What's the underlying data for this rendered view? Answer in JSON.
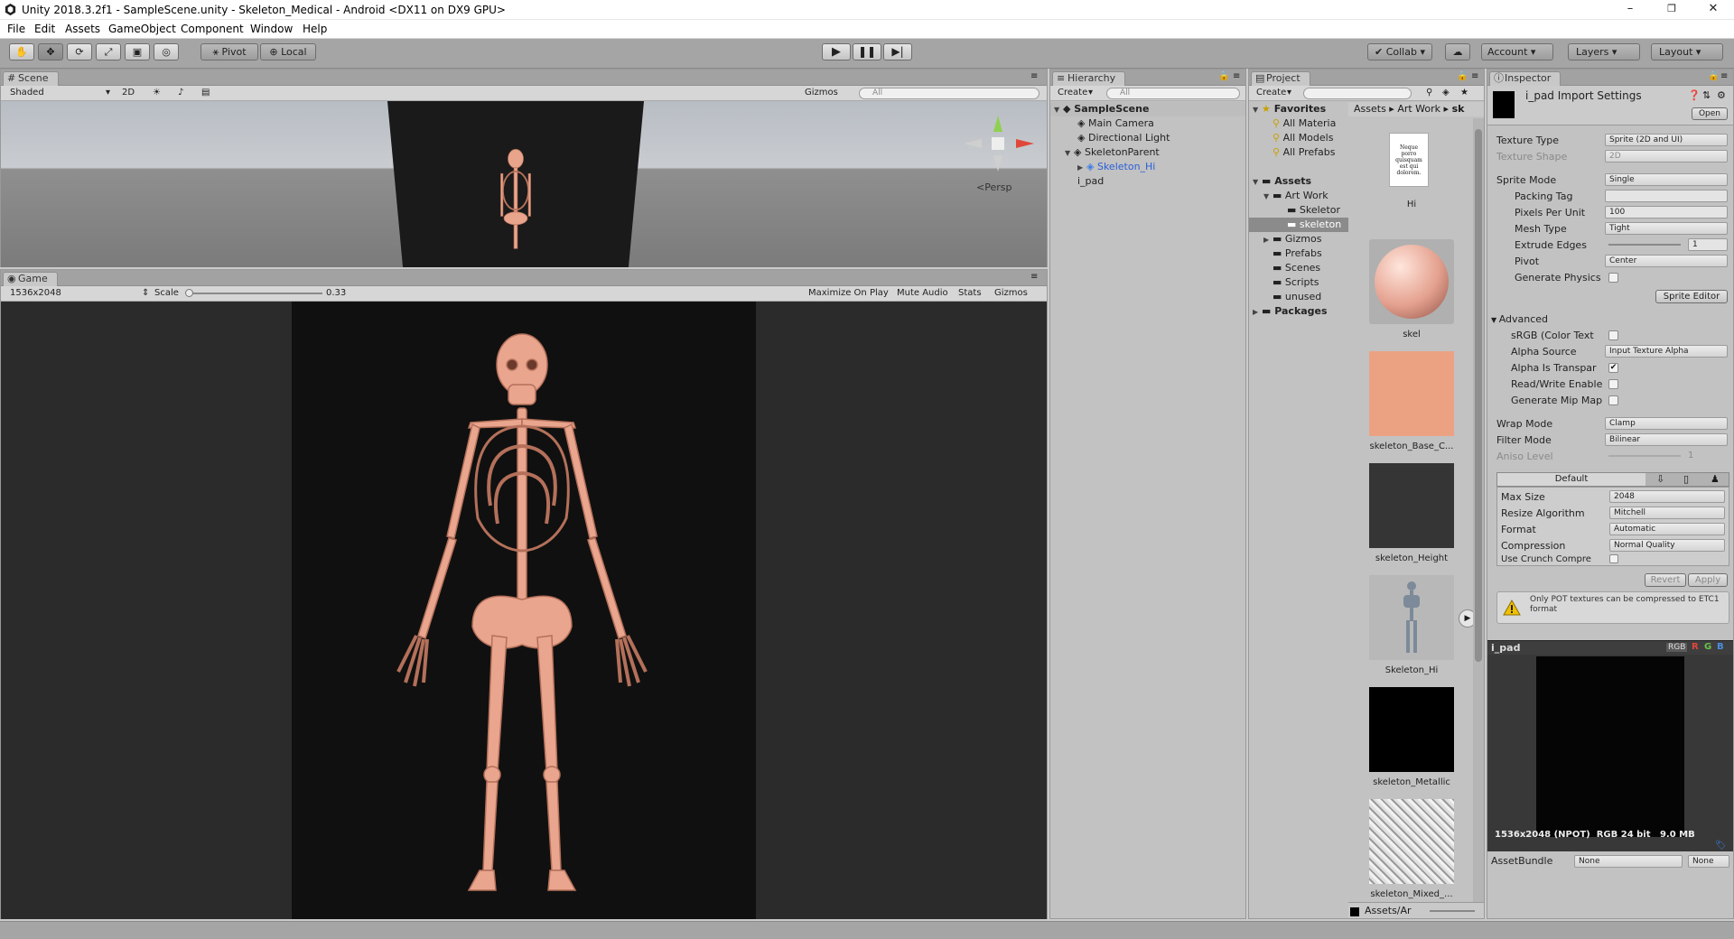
{
  "window": {
    "title": "Unity 2018.3.2f1 - SampleScene.unity - Skeleton_Medical - Android <DX11 on DX9 GPU>",
    "minimize": "–",
    "maximize": "❐",
    "close": "✕"
  },
  "menu": [
    "File",
    "Edit",
    "Assets",
    "GameObject",
    "Component",
    "Window",
    "Help"
  ],
  "toolbar": {
    "pivot": "Pivot",
    "local": "Local",
    "collab": "Collab ▾",
    "account": "Account",
    "layers": "Layers",
    "layout": "Layout"
  },
  "scene": {
    "tab": "Scene",
    "shading": "Shaded",
    "mode2d": "2D",
    "gizmos": "Gizmos",
    "search": "All",
    "persp": "<Persp"
  },
  "game": {
    "tab": "Game",
    "resolution": "1536x2048",
    "scale_label": "Scale",
    "scale_value": "0.33",
    "maximize": "Maximize On Play",
    "mute": "Mute Audio",
    "stats": "Stats",
    "gizmos": "Gizmos"
  },
  "hierarchy": {
    "tab": "Hierarchy",
    "create": "Create",
    "search": "All",
    "scene": "SampleScene",
    "items": [
      "Main Camera",
      "Directional Light",
      "SkeletonParent",
      "Skeleton_Hi",
      "i_pad"
    ]
  },
  "project": {
    "tab": "Project",
    "create": "Create",
    "breadcrumb": [
      "Assets",
      "Art Work",
      "sk"
    ],
    "favorites": "Favorites",
    "fav_items": [
      "All Materia",
      "All Models",
      "All Prefabs"
    ],
    "assets": "Assets",
    "tree": [
      "Art Work",
      "Skeletor",
      "skeleton",
      "Gizmos",
      "Prefabs",
      "Scenes",
      "Scripts",
      "unused"
    ],
    "packages": "Packages",
    "thumbs": [
      "Hi",
      "skel",
      "skeleton_Base_C...",
      "skeleton_Height",
      "Skeleton_Hi",
      "skeleton_Metallic",
      "skeleton_Mixed_..."
    ],
    "doc_text": "Neque porro quisquam est qui dolorem.",
    "footer": "Assets/Ar"
  },
  "inspector": {
    "tab": "Inspector",
    "title": "i_pad Import Settings",
    "open": "Open",
    "texture_type_label": "Texture Type",
    "texture_type": "Sprite (2D and UI)",
    "texture_shape_label": "Texture Shape",
    "texture_shape": "2D",
    "sprite_mode_label": "Sprite Mode",
    "sprite_mode": "Single",
    "packing_tag_label": "Packing Tag",
    "ppu_label": "Pixels Per Unit",
    "ppu": "100",
    "mesh_type_label": "Mesh Type",
    "mesh_type": "Tight",
    "extrude_label": "Extrude Edges",
    "extrude": "1",
    "pivot_label": "Pivot",
    "pivot": "Center",
    "gen_physics_label": "Generate Physics",
    "sprite_editor": "Sprite Editor",
    "advanced": "Advanced",
    "srgb_label": "sRGB (Color Text",
    "alpha_source_label": "Alpha Source",
    "alpha_source": "Input Texture Alpha",
    "alpha_transp_label": "Alpha Is Transpar",
    "rw_label": "Read/Write Enable",
    "mipmap_label": "Generate Mip Map",
    "wrap_label": "Wrap Mode",
    "wrap": "Clamp",
    "filter_label": "Filter Mode",
    "filter": "Bilinear",
    "aniso_label": "Aniso Level",
    "aniso": "1",
    "platform_default": "Default",
    "maxsize_label": "Max Size",
    "maxsize": "2048",
    "resize_label": "Resize Algorithm",
    "resize": "Mitchell",
    "format_label": "Format",
    "format": "Automatic",
    "compression_label": "Compression",
    "compression": "Normal Quality",
    "crunch_label": "Use Crunch Compre",
    "revert": "Revert",
    "apply": "Apply",
    "warning": "Only POT textures can be compressed to ETC1 format",
    "preview_name": "i_pad",
    "preview_rgb": "RGB",
    "preview_r": "R",
    "preview_g": "G",
    "preview_b": "B",
    "preview_info": "1536x2048 (NPOT)  RGB 24 bit   9.0 MB",
    "assetbundle_label": "AssetBundle",
    "assetbundle": "None",
    "assetbundle_variant": "None"
  },
  "colors": {
    "selection": "#3e7de6",
    "bone": "#e8a58c",
    "warning": "#f0c000"
  }
}
